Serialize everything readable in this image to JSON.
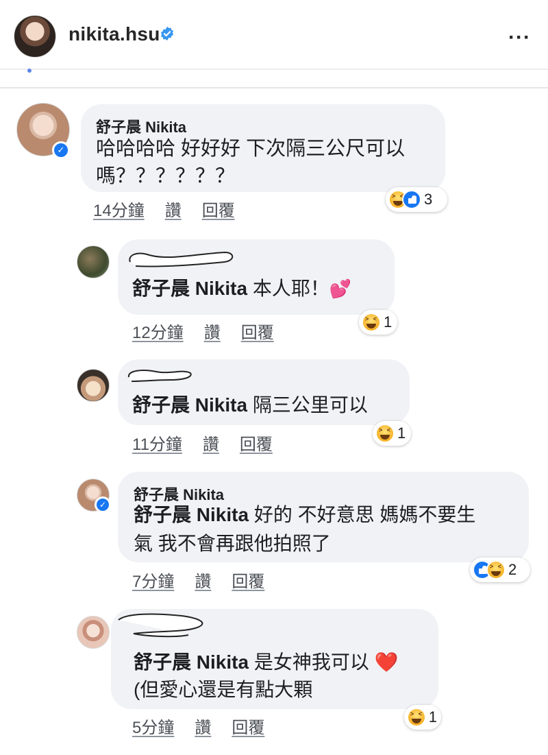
{
  "header": {
    "username": "nikita.hsu",
    "more_icon": "more-horizontal-icon",
    "verified_icon": "verified-badge-icon"
  },
  "comments": [
    {
      "author": "舒子晨 Nikita",
      "lines": [
        "哈哈哈哈 好好好 下次隔三公尺可以",
        "嗎？？？？？？"
      ],
      "time": "14分鐘",
      "like": "讚",
      "reply": "回覆",
      "reactions": [
        "haha",
        "like"
      ],
      "reaction_count": "3",
      "verified": true
    },
    {
      "author_hidden": true,
      "mention": "舒子晨 Nikita",
      "text": "本人耶！",
      "emoji": "💕",
      "time": "12分鐘",
      "like": "讚",
      "reply": "回覆",
      "reactions": [
        "haha"
      ],
      "reaction_count": "1"
    },
    {
      "author_hidden": true,
      "mention": "舒子晨 Nikita",
      "text": "隔三公里可以",
      "time": "11分鐘",
      "like": "讚",
      "reply": "回覆",
      "reactions": [
        "haha"
      ],
      "reaction_count": "1"
    },
    {
      "author": "舒子晨 Nikita",
      "mention": "舒子晨 Nikita",
      "line1_rest": "好的 不好意思 媽媽不要生",
      "line2": "氣 我不會再跟他拍照了",
      "time": "7分鐘",
      "like": "讚",
      "reply": "回覆",
      "reactions": [
        "like",
        "haha"
      ],
      "reaction_count": "2",
      "verified": true
    },
    {
      "author_hidden": true,
      "mention": "舒子晨 Nikita",
      "line1_rest": "是女神我可以",
      "emoji": "❤️",
      "line2": "(但愛心還是有點大顆",
      "time": "5分鐘",
      "like": "讚",
      "reply": "回覆",
      "reactions": [
        "haha"
      ],
      "reaction_count": "1"
    }
  ],
  "colors": {
    "bubble": "#f0f2f5",
    "like_blue": "#1877f2",
    "haha_yellow": "#f7b125",
    "heart_red": "#e02c2c"
  }
}
